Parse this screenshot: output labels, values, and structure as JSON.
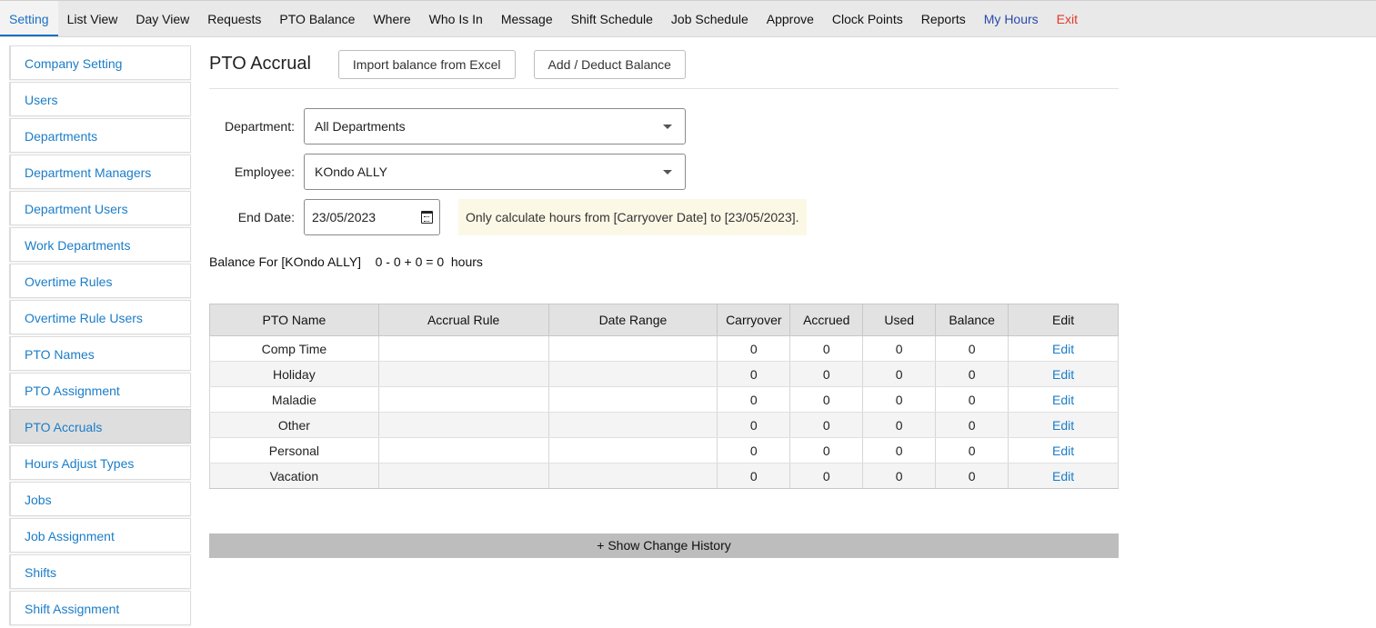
{
  "topnav": {
    "items": [
      {
        "label": "Setting"
      },
      {
        "label": "List View"
      },
      {
        "label": "Day View"
      },
      {
        "label": "Requests"
      },
      {
        "label": "PTO Balance"
      },
      {
        "label": "Where"
      },
      {
        "label": "Who Is In"
      },
      {
        "label": "Message"
      },
      {
        "label": "Shift Schedule"
      },
      {
        "label": "Job Schedule"
      },
      {
        "label": "Approve"
      },
      {
        "label": "Clock Points"
      },
      {
        "label": "Reports"
      },
      {
        "label": "My Hours"
      },
      {
        "label": "Exit"
      }
    ]
  },
  "sidebar": {
    "items": [
      {
        "label": "Company Setting"
      },
      {
        "label": "Users"
      },
      {
        "label": "Departments"
      },
      {
        "label": "Department Managers"
      },
      {
        "label": "Department Users"
      },
      {
        "label": "Work Departments"
      },
      {
        "label": "Overtime Rules"
      },
      {
        "label": "Overtime Rule Users"
      },
      {
        "label": "PTO Names"
      },
      {
        "label": "PTO Assignment"
      },
      {
        "label": "PTO Accruals"
      },
      {
        "label": "Hours Adjust Types"
      },
      {
        "label": "Jobs"
      },
      {
        "label": "Job Assignment"
      },
      {
        "label": "Shifts"
      },
      {
        "label": "Shift Assignment"
      }
    ]
  },
  "header": {
    "title": "PTO Accrual",
    "import_label": "Import balance from Excel",
    "add_deduct_label": "Add / Deduct Balance"
  },
  "form": {
    "department_label": "Department:",
    "department_value": "All Departments",
    "employee_label": "Employee:",
    "employee_value": "KOndo ALLY",
    "end_date_label": "End Date:",
    "end_date_value": "23/05/2023",
    "note": "Only calculate hours from [Carryover Date] to [23/05/2023]."
  },
  "balance": {
    "text": "Balance For [KOndo ALLY]    0 - 0 + 0 = 0  hours"
  },
  "table": {
    "headers": [
      "PTO Name",
      "Accrual Rule",
      "Date Range",
      "Carryover",
      "Accrued",
      "Used",
      "Balance",
      "Edit"
    ],
    "rows": [
      {
        "name": "Comp Time",
        "rule": "",
        "range": "",
        "carryover": "0",
        "accrued": "0",
        "used": "0",
        "balance": "0",
        "edit": "Edit"
      },
      {
        "name": "Holiday",
        "rule": "",
        "range": "",
        "carryover": "0",
        "accrued": "0",
        "used": "0",
        "balance": "0",
        "edit": "Edit"
      },
      {
        "name": "Maladie",
        "rule": "",
        "range": "",
        "carryover": "0",
        "accrued": "0",
        "used": "0",
        "balance": "0",
        "edit": "Edit"
      },
      {
        "name": "Other",
        "rule": "",
        "range": "",
        "carryover": "0",
        "accrued": "0",
        "used": "0",
        "balance": "0",
        "edit": "Edit"
      },
      {
        "name": "Personal",
        "rule": "",
        "range": "",
        "carryover": "0",
        "accrued": "0",
        "used": "0",
        "balance": "0",
        "edit": "Edit"
      },
      {
        "name": "Vacation",
        "rule": "",
        "range": "",
        "carryover": "0",
        "accrued": "0",
        "used": "0",
        "balance": "0",
        "edit": "Edit"
      }
    ]
  },
  "history": {
    "label": "+ Show Change History"
  }
}
